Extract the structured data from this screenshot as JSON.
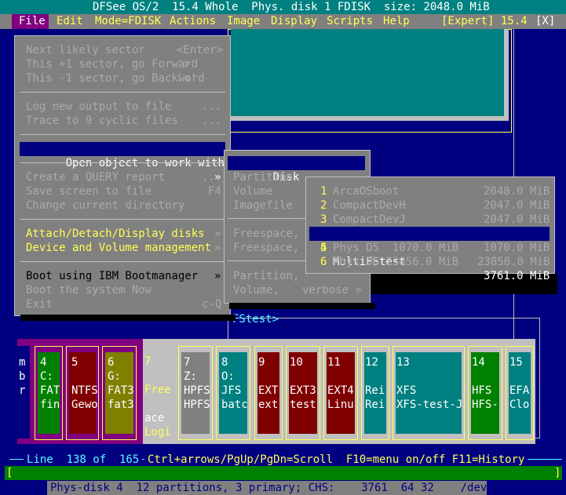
{
  "title": "DFSee OS/2  15.4 Whole  Phys. disk 1 FDISK  size: 2048.0 MiB",
  "close_label": "[X]",
  "menubar": {
    "items": [
      "File",
      "Edit",
      "Mode=FDISK",
      "Actions",
      "Image",
      "Display",
      "Scripts",
      "Help"
    ],
    "expert": "[Expert] 15.4"
  },
  "file_menu": {
    "items": [
      {
        "label": "Next likely sector",
        "shortcut": "<Enter>"
      },
      {
        "label": "This +1 sector, go Forward",
        "shortcut": "'>'"
      },
      {
        "label": "This -1 sector, go Backward",
        "shortcut": "'<'"
      },
      {
        "label": "Log new output to file",
        "shortcut": "..."
      },
      {
        "label": "Trace to 9 cyclic files",
        "shortcut": "..."
      },
      {
        "label": "Open object to work with",
        "shortcut": "»"
      },
      {
        "label": "Create a QUERY report",
        "shortcut": "..."
      },
      {
        "label": "Save screen to file",
        "shortcut": "F4"
      },
      {
        "label": "Change current directory",
        "shortcut": ""
      },
      {
        "label": "Attach/Detach/Display disks",
        "shortcut": "»"
      },
      {
        "label": "Device and Volume management",
        "shortcut": "»"
      },
      {
        "label": "Boot using IBM Bootmanager",
        "shortcut": "»"
      },
      {
        "label": "Boot the system Now",
        "shortcut": ""
      },
      {
        "label": "Exit",
        "shortcut": "c-Q"
      }
    ]
  },
  "open_menu": {
    "items": [
      {
        "label": "Disk",
        "shortcut": "»"
      },
      {
        "label": "Partition",
        "shortcut": ""
      },
      {
        "label": "Volume",
        "shortcut": ""
      },
      {
        "label": "Imagefile",
        "shortcut": ""
      },
      {
        "label": "Freespace,",
        "shortcut": ""
      },
      {
        "label": "Freespace,",
        "shortcut": ""
      },
      {
        "label": "Partition,",
        "shortcut": ""
      },
      {
        "label": "Volume,",
        "shortcut": "verbose »"
      }
    ]
  },
  "disk_menu": {
    "items": [
      {
        "num": "1",
        "name": "ArcaOSboot",
        "size": "2048.0 MiB"
      },
      {
        "num": "2",
        "name": "CompactDevH",
        "size": "2047.0 MiB"
      },
      {
        "num": "3",
        "name": "CompactDevJ",
        "size": "2047.0 MiB"
      },
      {
        "num": "4",
        "name": "MultiFStest",
        "size": "3761.0 MiB"
      },
      {
        "num": "5",
        "name": "Phys D5  1070.0 MiB",
        "size": "1070.0 MiB"
      },
      {
        "num": "6",
        "name": "Phys D6 23856.0 MiB",
        "size": "23856.0 MiB"
      }
    ]
  },
  "frame_label": "FStest>",
  "mbr_label": [
    "m",
    "b",
    "r"
  ],
  "partitions": [
    {
      "num": "4",
      "l2": "C:",
      "l3": "FAT",
      "l4": "fin"
    },
    {
      "num": "5",
      "l2": "",
      "l3": "NTFS",
      "l4": "Gewo"
    },
    {
      "num": "6",
      "l2": "G:",
      "l3": "FAT3",
      "l4": "fat3"
    },
    {
      "num": "7",
      "l2": "",
      "l3": "Free",
      "l4": "ace",
      "l5": "Logi"
    },
    {
      "num": "7",
      "l2": "Z:",
      "l3": "HPFS",
      "l4": "HPFS"
    },
    {
      "num": "8",
      "l2": "O:",
      "l3": "JFS",
      "l4": "batc"
    },
    {
      "num": "9",
      "l2": "",
      "l3": "EXT",
      "l4": "ext"
    },
    {
      "num": "10",
      "l2": "",
      "l3": "EXT3",
      "l4": "test"
    },
    {
      "num": "11",
      "l2": "",
      "l3": "EXT4",
      "l4": "Linu"
    },
    {
      "num": "12",
      "l2": "",
      "l3": "Rei",
      "l4": "Rei"
    },
    {
      "num": "13",
      "l2": "",
      "l3": "XFS",
      "l4": "XFS-test-J"
    },
    {
      "num": "14",
      "l2": "",
      "l3": "HFS",
      "l4": "HFS-"
    },
    {
      "num": "15",
      "l2": "",
      "l3": "EFA",
      "l4": "Clo"
    }
  ],
  "status": {
    "line_info": "Line  138 of  165",
    "keys": "Ctrl+arrows/PgUp/PgDn=Scroll  F10=menu on/off F11=History",
    "cmd_left": "[",
    "cmd_right": "]",
    "bottom": "Phys-disk 4  12 partitions, 3 primary; CHS:    3761  64 32    /dev/sdd"
  },
  "colors": {
    "background": "#000080",
    "menu_bg": "#808080",
    "hotkey": "#ffff55",
    "selection": "#000080",
    "title_bg": "#008080",
    "active_menu": "#800080"
  }
}
